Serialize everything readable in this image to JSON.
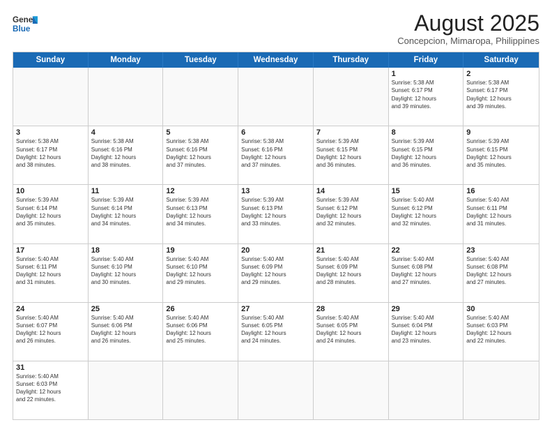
{
  "header": {
    "logo_general": "General",
    "logo_blue": "Blue",
    "month_title": "August 2025",
    "subtitle": "Concepcion, Mimaropa, Philippines"
  },
  "weekdays": [
    "Sunday",
    "Monday",
    "Tuesday",
    "Wednesday",
    "Thursday",
    "Friday",
    "Saturday"
  ],
  "weeks": [
    [
      {
        "day": "",
        "info": ""
      },
      {
        "day": "",
        "info": ""
      },
      {
        "day": "",
        "info": ""
      },
      {
        "day": "",
        "info": ""
      },
      {
        "day": "",
        "info": ""
      },
      {
        "day": "1",
        "info": "Sunrise: 5:38 AM\nSunset: 6:17 PM\nDaylight: 12 hours\nand 39 minutes."
      },
      {
        "day": "2",
        "info": "Sunrise: 5:38 AM\nSunset: 6:17 PM\nDaylight: 12 hours\nand 39 minutes."
      }
    ],
    [
      {
        "day": "3",
        "info": "Sunrise: 5:38 AM\nSunset: 6:17 PM\nDaylight: 12 hours\nand 38 minutes."
      },
      {
        "day": "4",
        "info": "Sunrise: 5:38 AM\nSunset: 6:16 PM\nDaylight: 12 hours\nand 38 minutes."
      },
      {
        "day": "5",
        "info": "Sunrise: 5:38 AM\nSunset: 6:16 PM\nDaylight: 12 hours\nand 37 minutes."
      },
      {
        "day": "6",
        "info": "Sunrise: 5:38 AM\nSunset: 6:16 PM\nDaylight: 12 hours\nand 37 minutes."
      },
      {
        "day": "7",
        "info": "Sunrise: 5:39 AM\nSunset: 6:15 PM\nDaylight: 12 hours\nand 36 minutes."
      },
      {
        "day": "8",
        "info": "Sunrise: 5:39 AM\nSunset: 6:15 PM\nDaylight: 12 hours\nand 36 minutes."
      },
      {
        "day": "9",
        "info": "Sunrise: 5:39 AM\nSunset: 6:15 PM\nDaylight: 12 hours\nand 35 minutes."
      }
    ],
    [
      {
        "day": "10",
        "info": "Sunrise: 5:39 AM\nSunset: 6:14 PM\nDaylight: 12 hours\nand 35 minutes."
      },
      {
        "day": "11",
        "info": "Sunrise: 5:39 AM\nSunset: 6:14 PM\nDaylight: 12 hours\nand 34 minutes."
      },
      {
        "day": "12",
        "info": "Sunrise: 5:39 AM\nSunset: 6:13 PM\nDaylight: 12 hours\nand 34 minutes."
      },
      {
        "day": "13",
        "info": "Sunrise: 5:39 AM\nSunset: 6:13 PM\nDaylight: 12 hours\nand 33 minutes."
      },
      {
        "day": "14",
        "info": "Sunrise: 5:39 AM\nSunset: 6:12 PM\nDaylight: 12 hours\nand 32 minutes."
      },
      {
        "day": "15",
        "info": "Sunrise: 5:40 AM\nSunset: 6:12 PM\nDaylight: 12 hours\nand 32 minutes."
      },
      {
        "day": "16",
        "info": "Sunrise: 5:40 AM\nSunset: 6:11 PM\nDaylight: 12 hours\nand 31 minutes."
      }
    ],
    [
      {
        "day": "17",
        "info": "Sunrise: 5:40 AM\nSunset: 6:11 PM\nDaylight: 12 hours\nand 31 minutes."
      },
      {
        "day": "18",
        "info": "Sunrise: 5:40 AM\nSunset: 6:10 PM\nDaylight: 12 hours\nand 30 minutes."
      },
      {
        "day": "19",
        "info": "Sunrise: 5:40 AM\nSunset: 6:10 PM\nDaylight: 12 hours\nand 29 minutes."
      },
      {
        "day": "20",
        "info": "Sunrise: 5:40 AM\nSunset: 6:09 PM\nDaylight: 12 hours\nand 29 minutes."
      },
      {
        "day": "21",
        "info": "Sunrise: 5:40 AM\nSunset: 6:09 PM\nDaylight: 12 hours\nand 28 minutes."
      },
      {
        "day": "22",
        "info": "Sunrise: 5:40 AM\nSunset: 6:08 PM\nDaylight: 12 hours\nand 27 minutes."
      },
      {
        "day": "23",
        "info": "Sunrise: 5:40 AM\nSunset: 6:08 PM\nDaylight: 12 hours\nand 27 minutes."
      }
    ],
    [
      {
        "day": "24",
        "info": "Sunrise: 5:40 AM\nSunset: 6:07 PM\nDaylight: 12 hours\nand 26 minutes."
      },
      {
        "day": "25",
        "info": "Sunrise: 5:40 AM\nSunset: 6:06 PM\nDaylight: 12 hours\nand 26 minutes."
      },
      {
        "day": "26",
        "info": "Sunrise: 5:40 AM\nSunset: 6:06 PM\nDaylight: 12 hours\nand 25 minutes."
      },
      {
        "day": "27",
        "info": "Sunrise: 5:40 AM\nSunset: 6:05 PM\nDaylight: 12 hours\nand 24 minutes."
      },
      {
        "day": "28",
        "info": "Sunrise: 5:40 AM\nSunset: 6:05 PM\nDaylight: 12 hours\nand 24 minutes."
      },
      {
        "day": "29",
        "info": "Sunrise: 5:40 AM\nSunset: 6:04 PM\nDaylight: 12 hours\nand 23 minutes."
      },
      {
        "day": "30",
        "info": "Sunrise: 5:40 AM\nSunset: 6:03 PM\nDaylight: 12 hours\nand 22 minutes."
      }
    ],
    [
      {
        "day": "31",
        "info": "Sunrise: 5:40 AM\nSunset: 6:03 PM\nDaylight: 12 hours\nand 22 minutes."
      },
      {
        "day": "",
        "info": ""
      },
      {
        "day": "",
        "info": ""
      },
      {
        "day": "",
        "info": ""
      },
      {
        "day": "",
        "info": ""
      },
      {
        "day": "",
        "info": ""
      },
      {
        "day": "",
        "info": ""
      }
    ]
  ]
}
